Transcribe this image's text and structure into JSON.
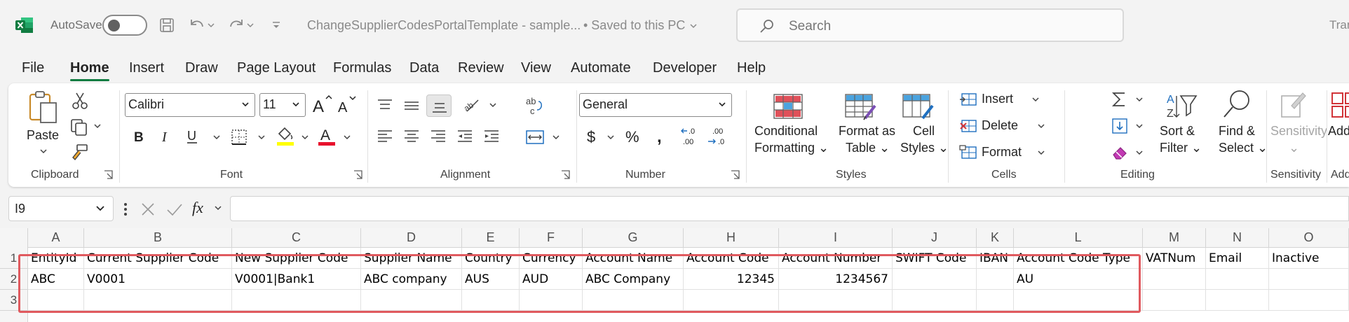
{
  "app": {
    "autosave_label": "AutoSave",
    "document_title": "ChangeSupplierCodesPortalTemplate - sample...",
    "save_status": "• Saved to this PC",
    "search_placeholder": "Search",
    "user_stub": "Tran",
    "brand_color": "#107c41"
  },
  "tabs": [
    {
      "label": "File"
    },
    {
      "label": "Home",
      "active": true
    },
    {
      "label": "Insert"
    },
    {
      "label": "Draw"
    },
    {
      "label": "Page Layout"
    },
    {
      "label": "Formulas"
    },
    {
      "label": "Data"
    },
    {
      "label": "Review"
    },
    {
      "label": "View"
    },
    {
      "label": "Automate"
    },
    {
      "label": "Developer"
    },
    {
      "label": "Help"
    }
  ],
  "ribbon": {
    "clipboard": {
      "label": "Clipboard",
      "paste": "Paste"
    },
    "font": {
      "label": "Font",
      "font_name": "Calibri",
      "font_size": "11",
      "font_color": "#e8112d",
      "highlight_color": "#ffff00"
    },
    "alignment": {
      "label": "Alignment"
    },
    "number": {
      "label": "Number",
      "format": "General"
    },
    "styles": {
      "label": "Styles",
      "conditional_1": "Conditional",
      "conditional_2": "Formatting",
      "format_table_1": "Format as",
      "format_table_2": "Table",
      "cell_styles_1": "Cell",
      "cell_styles_2": "Styles"
    },
    "cells": {
      "label": "Cells",
      "insert": "Insert",
      "delete": "Delete",
      "format": "Format"
    },
    "editing": {
      "label": "Editing",
      "sort_1": "Sort &",
      "sort_2": "Filter",
      "find_1": "Find &",
      "find_2": "Select"
    },
    "sensitivity": {
      "label": "Sensitivity",
      "button": "Sensitivity"
    },
    "addins": {
      "label": "Add-ins",
      "button": "Add-ins"
    }
  },
  "formula_bar": {
    "name_box": "I9",
    "fx": "fx",
    "formula": ""
  },
  "sheet": {
    "columns": [
      "A",
      "B",
      "C",
      "D",
      "E",
      "F",
      "G",
      "H",
      "I",
      "J",
      "K",
      "L",
      "M",
      "N",
      "O"
    ],
    "row_numbers": [
      "1",
      "2",
      "3"
    ],
    "rows": [
      [
        "EntityId",
        "Current Supplier Code",
        "New Supplier Code",
        "Supplier Name",
        "Country",
        "Currency",
        "Account Name",
        "Account Code",
        "Account Number",
        "SWIFT Code",
        "IBAN",
        "Account Code Type",
        "VATNum",
        "Email",
        "Inactive"
      ],
      [
        "ABC",
        "V0001",
        "V0001|Bank1",
        "ABC company",
        "AUS",
        "AUD",
        "ABC Company",
        "12345",
        "1234567",
        "",
        "",
        "AU",
        "",
        "",
        ""
      ],
      [
        "",
        "",
        "",
        "",
        "",
        "",
        "",
        "",
        "",
        "",
        "",
        "",
        "",
        "",
        ""
      ]
    ],
    "highlight_color": "#e05a5f"
  }
}
